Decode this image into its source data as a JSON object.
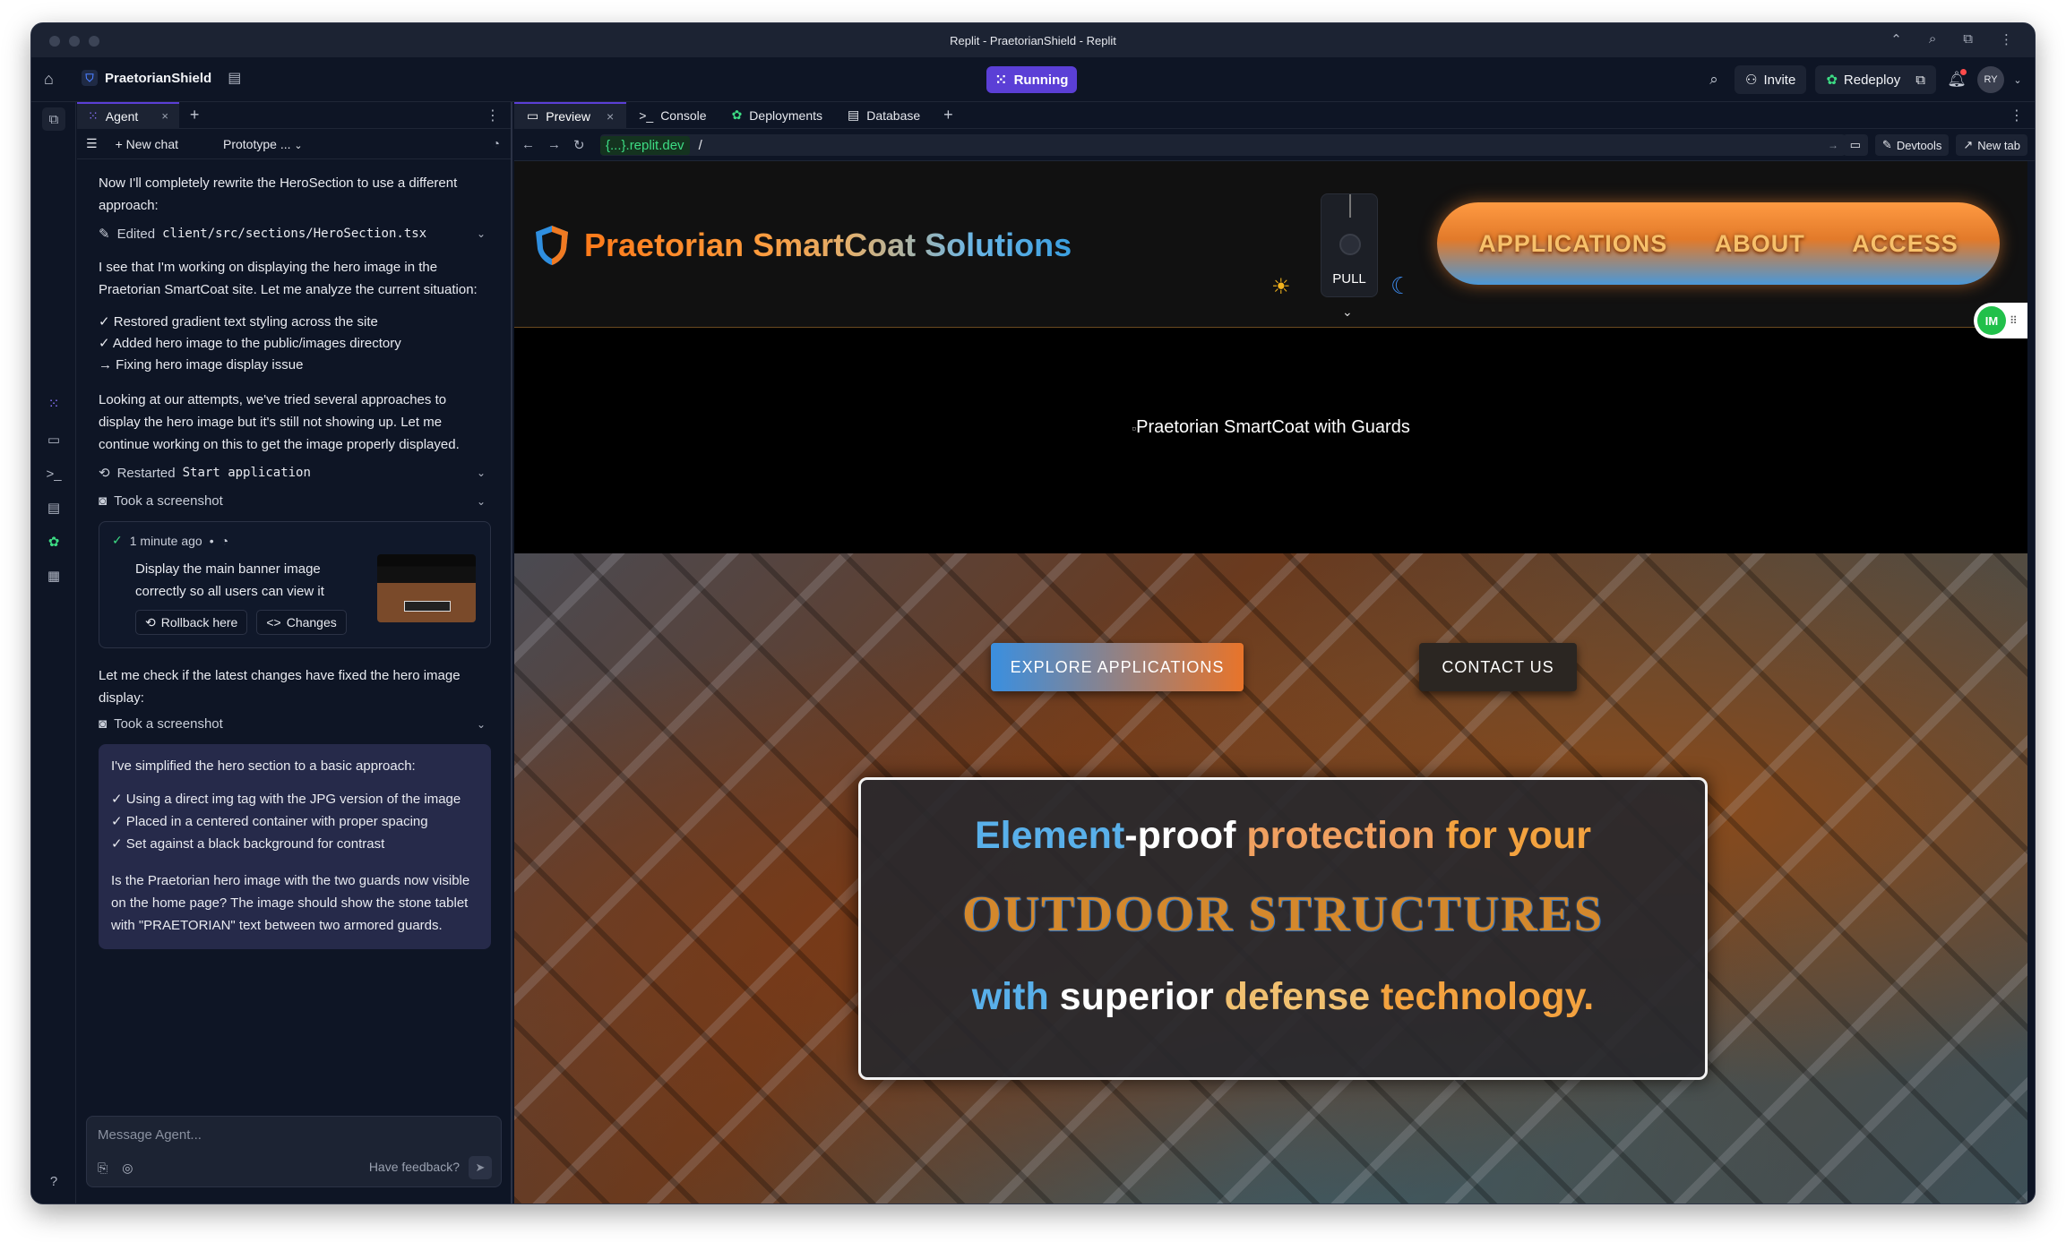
{
  "window": {
    "title": "Replit - PraetorianShield - Replit"
  },
  "appbar": {
    "project_name": "PraetorianShield",
    "status": "Running",
    "invite_label": "Invite",
    "redeploy_label": "Redeploy",
    "avatar_initials": "RY"
  },
  "agent": {
    "tab_label": "Agent",
    "new_chat_label": "New chat",
    "mode_label": "Prototype ...",
    "messages": {
      "m1": "Now I'll completely rewrite the HeroSection to use a different approach:",
      "edited_prefix": "Edited",
      "edited_file": "client/src/sections/HeroSection.tsx",
      "m2": "I see that I'm working on displaying the hero image in the Praetorian SmartCoat site. Let me analyze the current situation:",
      "list1": [
        "✓ Restored gradient text styling across the site",
        "✓ Added hero image to the public/images directory",
        "→ Fixing hero image display issue"
      ],
      "m3": "Looking at our attempts, we've tried several approaches to display the hero image but it's still not showing up. Let me continue working on this to get the image properly displayed.",
      "restarted_prefix": "Restarted",
      "restarted_name": "Start application",
      "screenshot_label": "Took a screenshot",
      "checkpoint_time": "1 minute ago",
      "checkpoint_desc": "Display the main banner image correctly so all users can view it",
      "rollback_label": "Rollback here",
      "changes_label": "Changes",
      "m4": "Let me check if the latest changes have fixed the hero image display:",
      "screenshot_label2": "Took a screenshot",
      "final_intro": "I've simplified the hero section to a basic approach:",
      "final_list": [
        "✓ Using a direct img tag with the JPG version of the image",
        "✓ Placed in a centered container with proper spacing",
        "✓ Set against a black background for contrast"
      ],
      "final_question": "Is the Praetorian hero image with the two guards now visible on the home page? The image should show the stone tablet with \"PRAETORIAN\" text between two armored guards."
    },
    "composer_placeholder": "Message Agent...",
    "feedback_label": "Have feedback?"
  },
  "workspace": {
    "tabs": [
      "Preview",
      "Console",
      "Deployments",
      "Database"
    ],
    "url_host": "{...}.replit.dev",
    "url_path": "/",
    "devtools_label": "Devtools",
    "newtab_label": "New tab"
  },
  "site": {
    "logo_text": "Praetorian SmartCoat Solutions",
    "pull_label": "PULL",
    "nav": [
      "APPLICATIONS",
      "ABOUT",
      "ACCESS"
    ],
    "badge": "IM",
    "broken_image_alt": "Praetorian SmartCoat with Guards",
    "explore_label": "EXPLORE APPLICATIONS",
    "contact_label": "CONTACT US",
    "tag1": {
      "a": "Element",
      "b": "-proof ",
      "c": "protection",
      "d": " for your"
    },
    "tag2": "OUTDOOR STRUCTURES",
    "tag3": {
      "a": "with ",
      "b": "superior ",
      "c": "defense ",
      "d": "technology."
    }
  },
  "colors": {
    "accent": "#5b3fd6",
    "running_green": "#3ddc84",
    "orange": "#e8742a",
    "blue": "#3a8fe0"
  }
}
